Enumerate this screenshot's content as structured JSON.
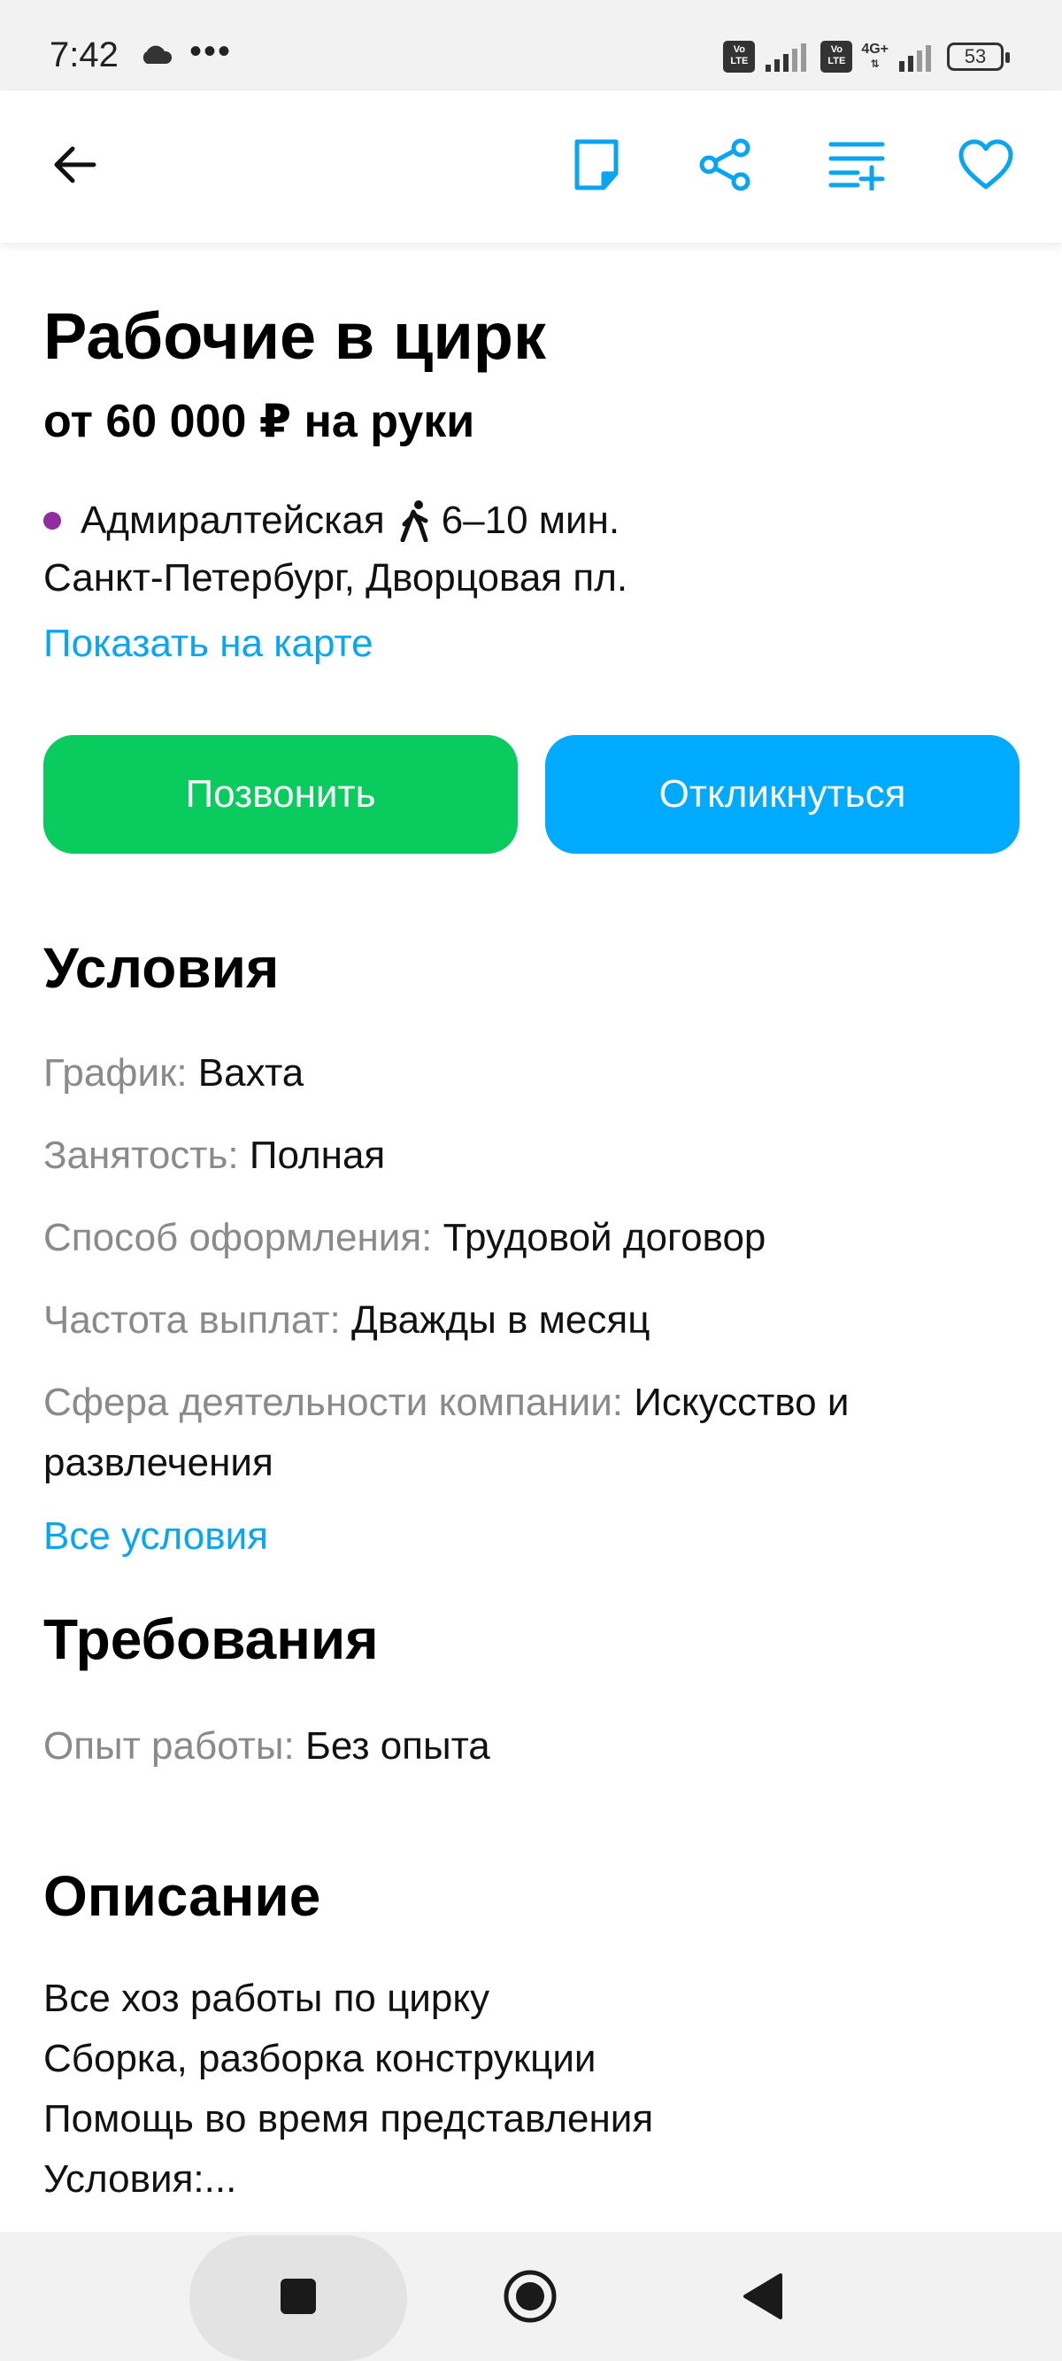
{
  "status": {
    "time": "7:42",
    "dots": "•••",
    "volte1": "Vo LTE",
    "volte2": "Vo LTE",
    "network": "4G+",
    "battery": "53"
  },
  "toolbar": {
    "icons": [
      "arrow-left-icon",
      "note-icon",
      "share-icon",
      "playlist-add-icon",
      "heart-icon"
    ]
  },
  "job": {
    "title": "Рабочие в цирк",
    "salary": "от 60 000 ₽ на руки",
    "metro_station": "Адмиралтейская",
    "metro_color": "#8e2d9d",
    "walk_time": "6–10 мин.",
    "address": "Санкт-Петербург, Дворцовая пл.",
    "show_on_map": "Показать на карте"
  },
  "actions": {
    "call": "Позвонить",
    "apply": "Откликнуться",
    "call_color": "#0acc5e",
    "apply_color": "#00aaff"
  },
  "conditions": {
    "title": "Условия",
    "rows": [
      {
        "key": "График:",
        "value": "Вахта"
      },
      {
        "key": "Занятость:",
        "value": "Полная"
      },
      {
        "key": "Способ оформления:",
        "value": "Трудовой договор"
      },
      {
        "key": "Частота выплат:",
        "value": "Дважды в месяц"
      },
      {
        "key": "Сфера деятельности компании:",
        "value": "Искусство и развлечения"
      }
    ],
    "all_link": "Все условия"
  },
  "requirements": {
    "title": "Требования",
    "rows": [
      {
        "key": "Опыт работы:",
        "value": "Без опыта"
      }
    ]
  },
  "description": {
    "title": "Описание",
    "lines": [
      "Все хоз работы по цирку",
      "Сборка, разборка конструкции",
      "Помощь во время представления",
      "Условия:..."
    ]
  },
  "accent_color": "#0aa5f2",
  "navbar": {
    "icons": [
      "recents-square-icon",
      "home-circle-icon",
      "back-triangle-icon"
    ]
  }
}
